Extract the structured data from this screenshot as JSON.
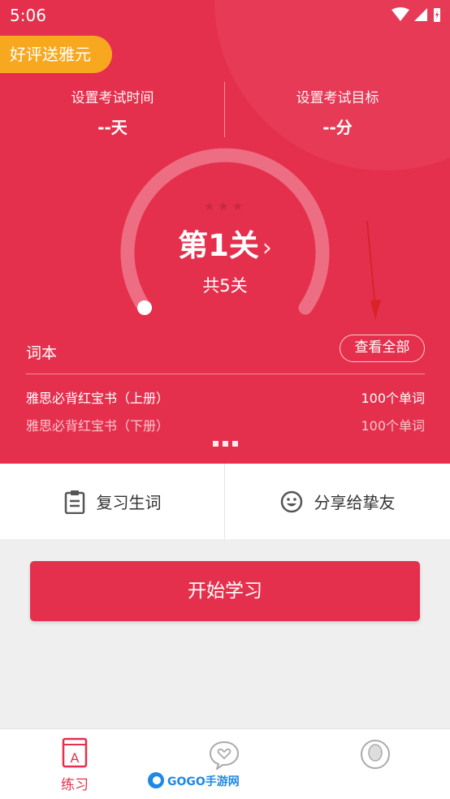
{
  "status_bar": {
    "time": "5:06"
  },
  "promo_badge": "好评送雅元",
  "exam_time": {
    "label": "设置考试时间",
    "value": "--天"
  },
  "exam_target": {
    "label": "设置考试目标",
    "value": "--分"
  },
  "progress": {
    "stars": "★★★",
    "level": "第1关",
    "level_arrow": "›",
    "total": "共5关"
  },
  "wordbook": {
    "title": "词本",
    "view_all": "查看全部",
    "books": [
      {
        "name": "雅思必背红宝书（上册）",
        "count": "100个单词"
      },
      {
        "name": "雅思必背红宝书（下册）",
        "count": "100个单词"
      }
    ]
  },
  "actions": {
    "review": "复习生词",
    "share": "分享给挚友"
  },
  "start_button": "开始学习",
  "tabbar": {
    "practice": "练习",
    "practice_icon_letter": "A"
  },
  "watermark": "GOGO手游网",
  "colors": {
    "primary": "#e5304d",
    "badge": "#f7a81f",
    "annotation_arrow": "#d8232a"
  }
}
